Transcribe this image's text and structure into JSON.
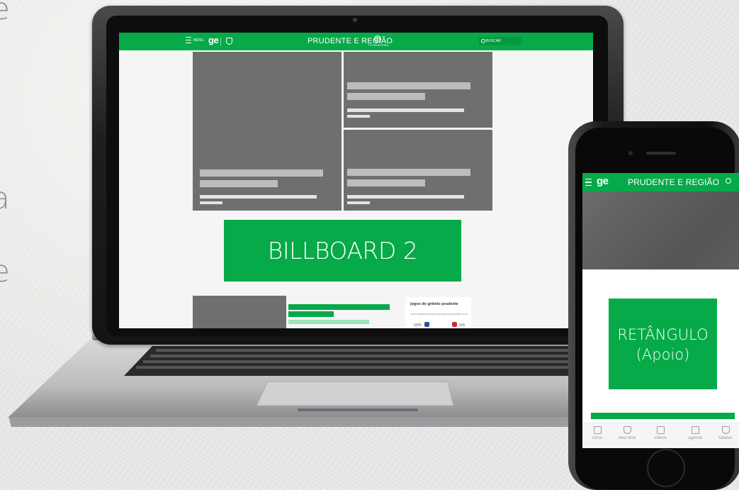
{
  "background_text": [
    "e",
    "a",
    "e"
  ],
  "laptop": {
    "header": {
      "menu_label": "MENU",
      "logo": "ge",
      "title": "PRUDENTE E REGIÃO",
      "tv_logo_label": "TV FRONTEIRA",
      "search_label": "BUSCAR"
    },
    "billboard_label": "BILLBOARD 2",
    "widget": {
      "title": "jogos do grêmio prudente",
      "subtitle": "19:30 CAMPEONATO PAULISTA SEGUNDA DIVISÃO 19:30",
      "team_home": "GPR",
      "team_away": "SIS"
    }
  },
  "phone": {
    "header": {
      "logo": "ge",
      "title": "PRUDENTE E REGIÃO"
    },
    "ad_line1": "RETÂNGULO",
    "ad_line2": "(Apoio)",
    "nav": [
      {
        "label": "início",
        "icon": "home-icon"
      },
      {
        "label": "meu time",
        "icon": "shield-icon"
      },
      {
        "label": "vídeos",
        "icon": "video-icon"
      },
      {
        "label": "agenda",
        "icon": "calendar-icon"
      },
      {
        "label": "tabelas",
        "icon": "trophy-icon"
      }
    ]
  },
  "colors": {
    "brand_green": "#06aa48",
    "placeholder_gray": "#6f6f6f"
  }
}
